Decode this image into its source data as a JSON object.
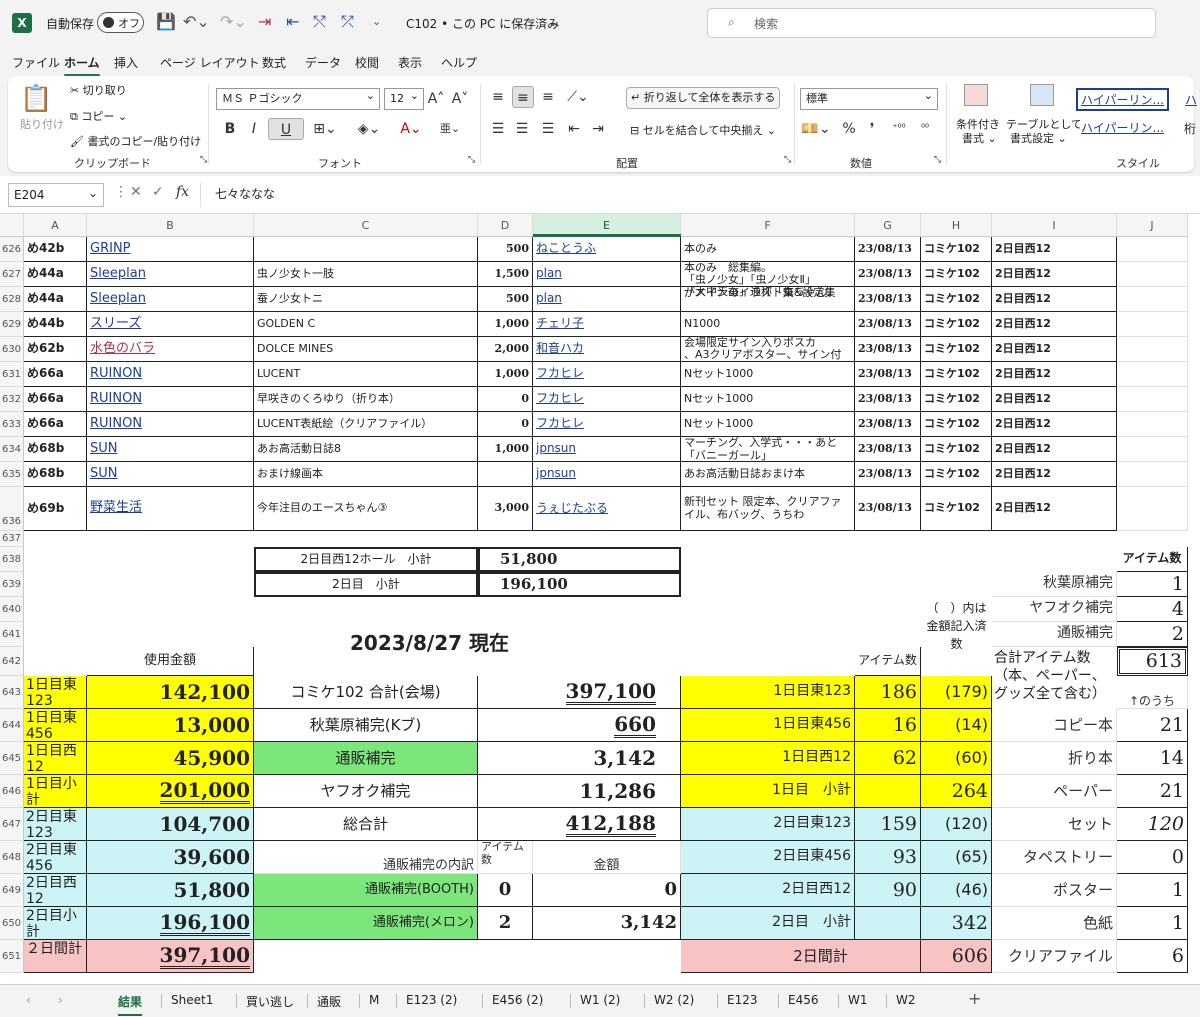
{
  "titlebar": {
    "autosave_label": "自動保存",
    "toggle_label": "オフ",
    "doc_title": "C102 • この PC に保存済み",
    "search_placeholder": "検索"
  },
  "menu": [
    "ファイル",
    "ホーム",
    "挿入",
    "ページ レイアウト",
    "数式",
    "データ",
    "校閲",
    "表示",
    "ヘルプ"
  ],
  "ribbon": {
    "paste": "貼り付け",
    "cut": "切り取り",
    "copy": "コピー",
    "format_painter": "書式のコピー/貼り付け",
    "clipboard": "クリップボード",
    "font_name": "ＭＳ Ｐゴシック",
    "font_size": "12",
    "font_group": "フォント",
    "bold": "B",
    "italic": "I",
    "underline": "U",
    "wrap": "折り返して全体を表示する",
    "merge": "セルを結合して中央揃え",
    "alignment": "配置",
    "number_format": "標準",
    "number_group": "数値",
    "cond_format_1": "条件付き",
    "cond_format_2": "書式 ⌄",
    "table_format_1": "テーブルとして",
    "table_format_2": "書式設定 ⌄",
    "style_1": "ハイパーリン...",
    "style_2": "ハイパーリン...",
    "style_3": "ハ",
    "style_4": "桁",
    "style_group": "スタイル"
  },
  "formula": {
    "name_box": "E204",
    "fx": "fx",
    "content": "七々ななな"
  },
  "columns": [
    "A",
    "B",
    "C",
    "D",
    "E",
    "F",
    "G",
    "H",
    "I",
    "J"
  ],
  "rows_top": [
    {
      "n": "626",
      "a": "め42b",
      "b": "GRINP",
      "c": "",
      "d": "500",
      "e": "ねことうふ",
      "f": "本のみ",
      "g": "23/08/13",
      "h": "コミケ102",
      "i": "2日目西12"
    },
    {
      "n": "627",
      "a": "め44a",
      "b": "Sleeplan",
      "c": "虫ノ少女ト一肢",
      "d": "1,500",
      "e": "plan",
      "f": "本のみ　総集編。",
      "g": "23/08/13",
      "h": "コミケ102",
      "i": "2日目西12"
    },
    {
      "n": "628",
      "a": "め44a",
      "b": "Sleeplan",
      "c": "蚕ノ少女トニ",
      "d": "500",
      "e": "plan",
      "f": "がメインのイラスト集&設定集",
      "g": "23/08/13",
      "h": "コミケ102",
      "i": "2日目西12"
    },
    {
      "n": "629",
      "a": "め44b",
      "b": "スリーズ",
      "c": "GOLDEN C",
      "d": "1,000",
      "e": "チェリ子",
      "f": "N1000",
      "g": "23/08/13",
      "h": "コミケ102",
      "i": "2日目西12"
    },
    {
      "n": "630",
      "a": "め62b",
      "b": "水色のバラ",
      "c": "DOLCE MINES",
      "d": "2,000",
      "e": "和音ハカ",
      "f": "会場限定サイン入りポスカ",
      "g": "23/08/13",
      "h": "コミケ102",
      "i": "2日目西12"
    },
    {
      "n": "631",
      "a": "め66a",
      "b": "RUINON",
      "c": "LUCENT",
      "d": "1,000",
      "e": "フカヒレ",
      "f": "Nセット1000",
      "g": "23/08/13",
      "h": "コミケ102",
      "i": "2日目西12"
    },
    {
      "n": "632",
      "a": "め66a",
      "b": "RUINON",
      "c": "早咲きのくろゆり（折り本）",
      "d": "0",
      "e": "フカヒレ",
      "f": "Nセット1000",
      "g": "23/08/13",
      "h": "コミケ102",
      "i": "2日目西12"
    },
    {
      "n": "633",
      "a": "め66a",
      "b": "RUINON",
      "c": "LUCENT表紙絵（クリアファイル）",
      "d": "0",
      "e": "フカヒレ",
      "f": "Nセット1000",
      "g": "23/08/13",
      "h": "コミケ102",
      "i": "2日目西12"
    },
    {
      "n": "634",
      "a": "め68b",
      "b": "SUN",
      "c": "あお高活動日誌8",
      "d": "1,000",
      "e": "jpnsun",
      "f": "マーチング、入学式・・・あと「バニーガール」",
      "g": "23/08/13",
      "h": "コミケ102",
      "i": "2日目西12"
    },
    {
      "n": "635",
      "a": "め68b",
      "b": "SUN",
      "c": "おまけ線画本",
      "d": "",
      "e": "jpnsun",
      "f": "あお高活動日誌おまけ本",
      "g": "23/08/13",
      "h": "コミケ102",
      "i": "2日目西12"
    },
    {
      "n": "636",
      "a": "め69b",
      "b": "野菜生活",
      "c": "今年注目のエースちゃん③",
      "d": "3,000",
      "e": "うぇじたぶる",
      "f": "新刊セット 限定本、クリアファイル、布バッグ、うちわ",
      "g": "23/08/13",
      "h": "コミケ102",
      "i": "2日目西12"
    }
  ],
  "row_numbers": [
    "637",
    "638",
    "639",
    "640",
    "641",
    "642",
    "643",
    "644",
    "645",
    "646",
    "647",
    "648",
    "649",
    "650",
    "651"
  ],
  "f627_line2": "「大中天蚕」通称「蚕ちゃん」",
  "f627_line1a": "「虫ノ少女」「虫ノ少女Ⅱ」",
  "f630_line2": "、A3クリアポスター、サイン付",
  "subtotal": {
    "label_hall": "2日目西12ホール　小計",
    "val_hall": "51,800",
    "label_day": "2日目　小計",
    "val_day": "196,100"
  },
  "report_date": "2023/8/27 現在",
  "spent": {
    "header": "使用金額",
    "rows": [
      {
        "label": "1日目東123",
        "value": "142,100"
      },
      {
        "label": "1日目東456",
        "value": "13,000"
      },
      {
        "label": "1日目西12",
        "value": "45,900"
      },
      {
        "label": "1日目小計",
        "value": "201,000"
      },
      {
        "label": "2日目東123",
        "value": "104,700"
      },
      {
        "label": "2日目東456",
        "value": "39,600"
      },
      {
        "label": "2日目西12",
        "value": "51,800"
      },
      {
        "label": "2日目小計",
        "value": "196,100"
      },
      {
        "label": "２日間計",
        "value": "397,100"
      }
    ]
  },
  "totals": [
    {
      "label": "コミケ102 合計(会場)",
      "value": "397,100"
    },
    {
      "label": "秋葉原補完(Kブ)",
      "value": "660"
    },
    {
      "label": "通販補完",
      "value": "3,142"
    },
    {
      "label": "ヤフオク補完",
      "value": "11,286"
    },
    {
      "label": "総合計",
      "value": "412,188"
    }
  ],
  "mail_breakdown": {
    "label": "通販補完の内訳",
    "item_header": "アイテム数",
    "amount_header": "金額",
    "rows": [
      {
        "label": "通販補完(BOOTH)",
        "items": "0",
        "amount": "0"
      },
      {
        "label": "通販補完(メロン)",
        "items": "2",
        "amount": "3,142"
      }
    ]
  },
  "item_header": "アイテム数",
  "paren_note": "（　）内は金額記入済数",
  "day_items": [
    {
      "label": "1日目東123",
      "items": "186",
      "paid": "(179)"
    },
    {
      "label": "1日目東456",
      "items": "16",
      "paid": "(14)"
    },
    {
      "label": "1日目西12",
      "items": "62",
      "paid": "(60)"
    },
    {
      "label": "1日目　小計",
      "items": "",
      "paid": "264"
    },
    {
      "label": "2日目東123",
      "items": "159",
      "paid": "(120)"
    },
    {
      "label": "2日目東456",
      "items": "93",
      "paid": "(65)"
    },
    {
      "label": "2日目西12",
      "items": "90",
      "paid": "(46)"
    },
    {
      "label": "2日目　小計",
      "items": "",
      "paid": "342"
    },
    {
      "label": "2日間計",
      "items": "",
      "paid": "606"
    }
  ],
  "right_panel": {
    "header": "アイテム数",
    "rows": [
      {
        "label": "秋葉原補完",
        "value": "1"
      },
      {
        "label": "ヤフオク補完",
        "value": "4"
      },
      {
        "label": "通販補完",
        "value": "2"
      }
    ],
    "total_label": "合計アイテム数（本、ペーパー、グッズ全て含む）",
    "total_value": "613",
    "sub_note": "↑のうち",
    "breakdown": [
      {
        "label": "コピー本",
        "value": "21"
      },
      {
        "label": "折り本",
        "value": "14"
      },
      {
        "label": "ペーパー",
        "value": "21"
      },
      {
        "label": "セット",
        "value": "120"
      },
      {
        "label": "タペストリー",
        "value": "0"
      },
      {
        "label": "ポスター",
        "value": "1"
      },
      {
        "label": "色紙",
        "value": "1"
      },
      {
        "label": "クリアファイル",
        "value": "6"
      }
    ]
  },
  "sheets": [
    "結果",
    "Sheet1",
    "買い逃し",
    "通販",
    "M",
    "E123 (2)",
    "E456 (2)",
    "W1 (2)",
    "W2 (2)",
    "E123",
    "E456",
    "W1",
    "W2"
  ]
}
